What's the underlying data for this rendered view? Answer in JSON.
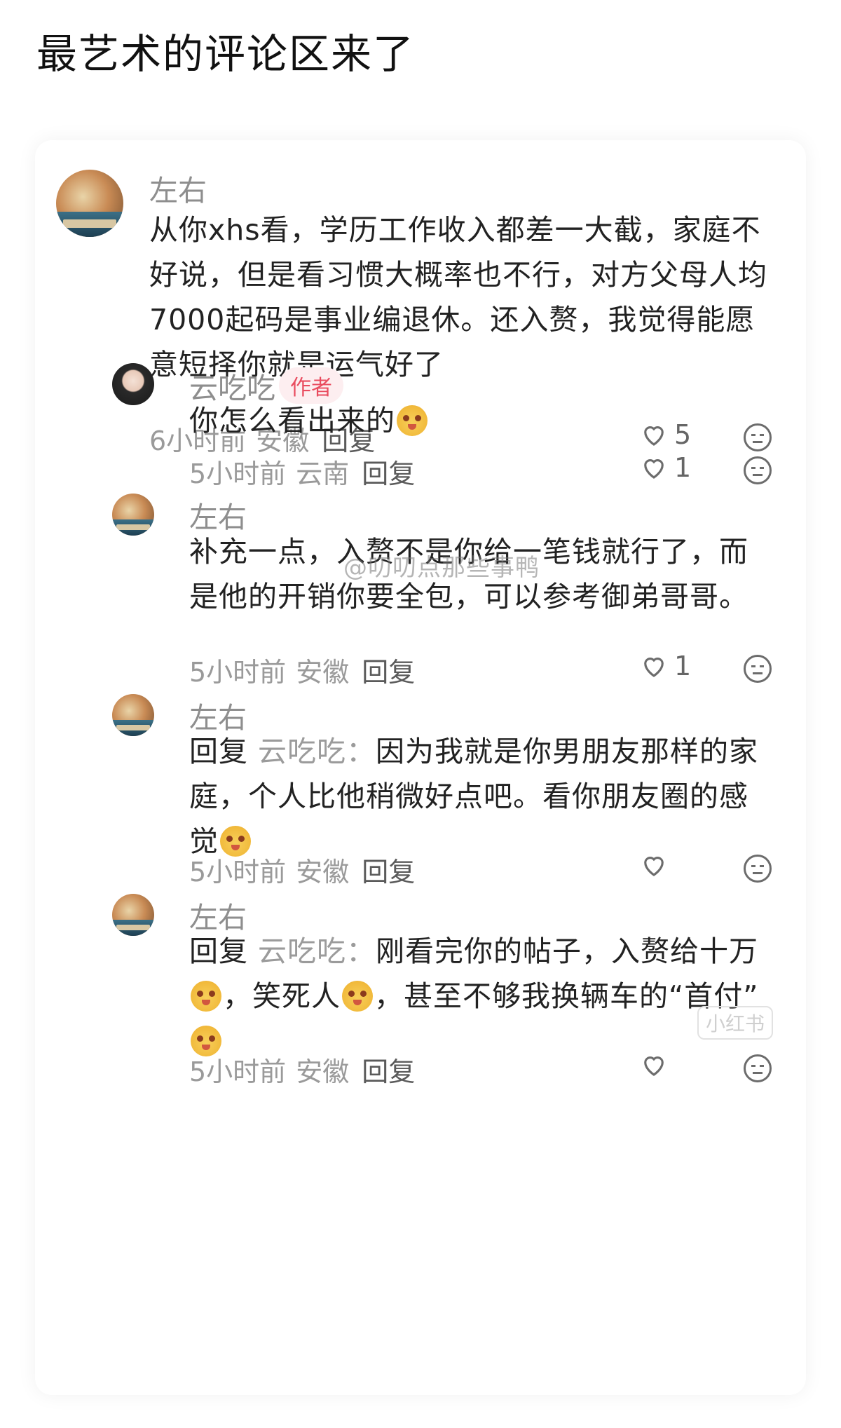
{
  "page": {
    "headline": "最艺术的评论区来了"
  },
  "watermark": "@叨叨点那些事鸭",
  "logo": "小红书",
  "comments": [
    {
      "user": "左右",
      "text": "从你xhs看，学历工作收入都差一大截，家庭不好说，但是看习惯大概率也不行，对方父母人均7000起码是事业编退休。还入赘，我觉得能愿意短择你就是运气好了",
      "time": "6小时前",
      "location": "安徽",
      "reply_label": "回复",
      "likes": "5"
    },
    {
      "user": "云吃吃",
      "badge": "作者",
      "text": "你怎么看出来的",
      "time": "5小时前",
      "location": "云南",
      "reply_label": "回复",
      "likes": "1"
    },
    {
      "user": "左右",
      "text": "补充一点，入赘不是你给一笔钱就行了，而是他的开销你要全包，可以参考御弟哥哥。",
      "time": "5小时前",
      "location": "安徽",
      "reply_label": "回复",
      "likes": "1"
    },
    {
      "user": "左右",
      "reply_prefix": "回复",
      "reply_target": "云吃吃：",
      "text": "因为我就是你男朋友那样的家庭，个人比他稍微好点吧。看你朋友圈的感觉",
      "time": "5小时前",
      "location": "安徽",
      "reply_label": "回复",
      "likes": ""
    },
    {
      "user": "左右",
      "reply_prefix": "回复",
      "reply_target": "云吃吃：",
      "text_a": "刚看完你的帖子，入赘给十万",
      "text_b": "，笑死人",
      "text_c": "，甚至不够我换辆车的“首付”",
      "time": "5小时前",
      "location": "安徽",
      "reply_label": "回复",
      "likes": ""
    }
  ]
}
